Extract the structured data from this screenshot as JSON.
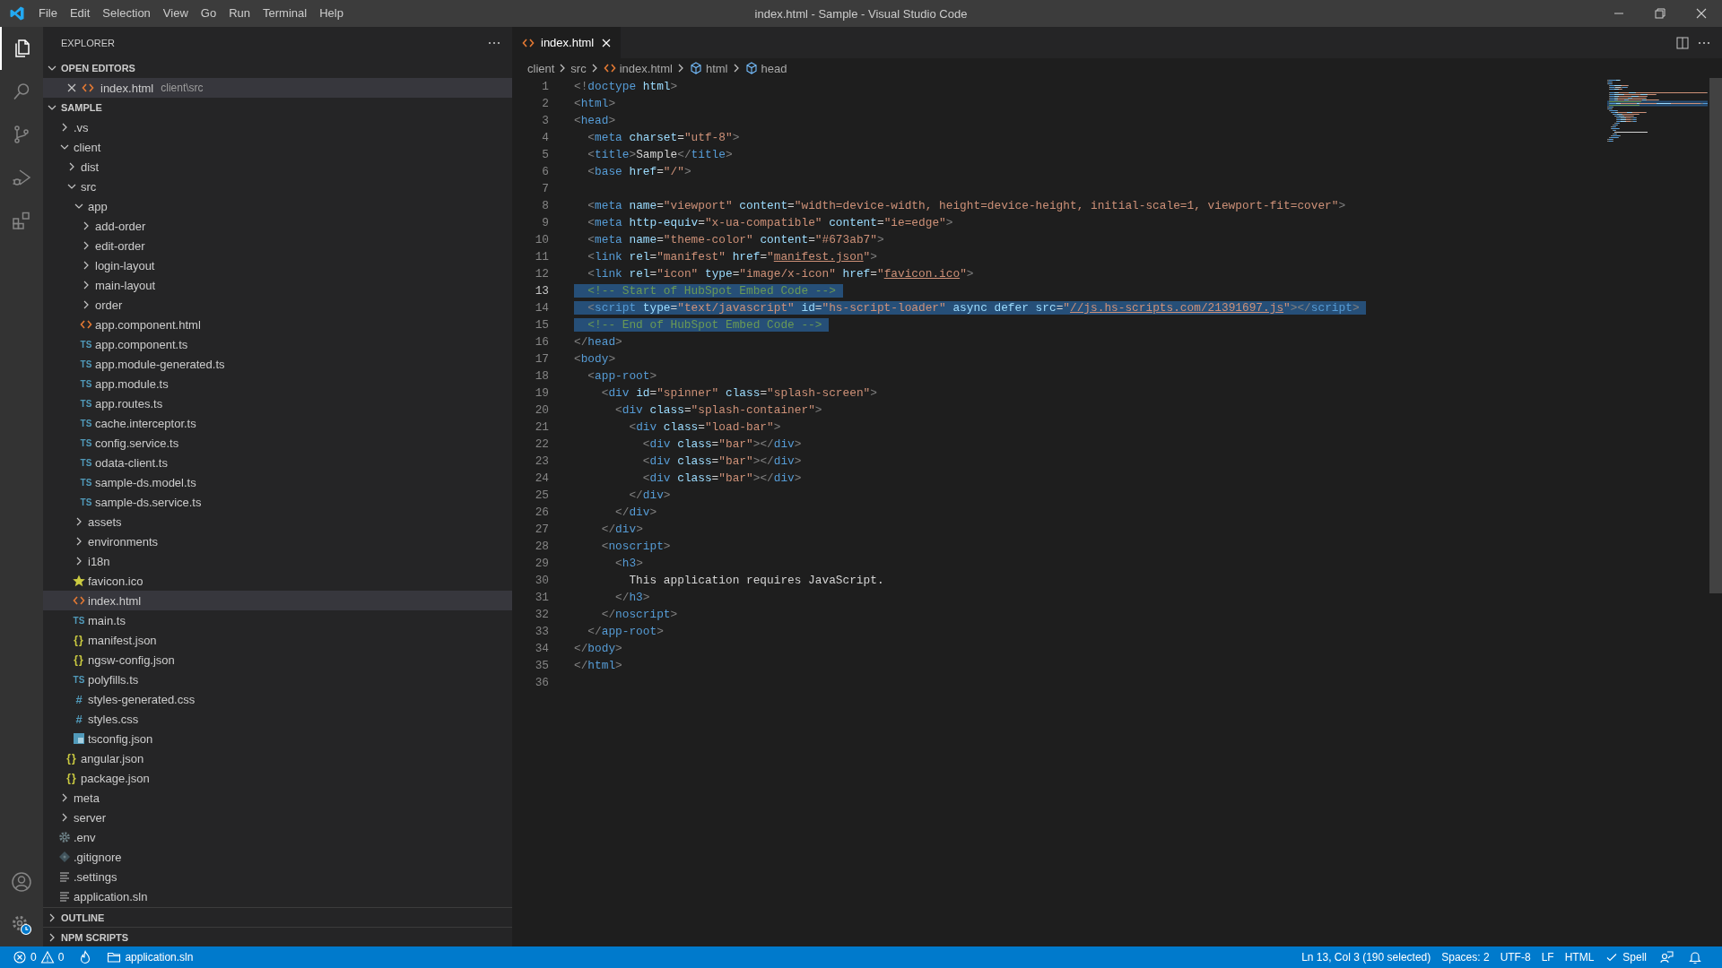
{
  "window": {
    "title": "index.html - Sample - Visual Studio Code"
  },
  "menu": [
    "File",
    "Edit",
    "Selection",
    "View",
    "Go",
    "Run",
    "Terminal",
    "Help"
  ],
  "activity_bar": {
    "top": [
      {
        "kind": "explorer",
        "selected": true
      },
      {
        "kind": "search",
        "selected": false
      },
      {
        "kind": "source-control",
        "selected": false
      },
      {
        "kind": "run",
        "selected": false
      },
      {
        "kind": "extensions",
        "selected": false
      }
    ],
    "bottom": [
      {
        "kind": "account"
      },
      {
        "kind": "settings"
      }
    ]
  },
  "sidebar": {
    "title": "EXPLORER",
    "open_editors": {
      "title": "OPEN EDITORS",
      "expanded": true,
      "items": [
        {
          "name": "index.html",
          "path": "client\\src",
          "kind": "html",
          "selected": true
        }
      ]
    },
    "folder": {
      "title": "SAMPLE",
      "expanded": true,
      "tree": [
        {
          "name": ".vs",
          "kind": "folder",
          "expanded": false,
          "selected": false
        },
        {
          "name": "client",
          "kind": "folder",
          "expanded": true,
          "selected": false,
          "children": [
            {
              "name": "dist",
              "kind": "folder",
              "expanded": false,
              "selected": false
            },
            {
              "name": "src",
              "kind": "folder",
              "expanded": true,
              "selected": false,
              "children": [
                {
                  "name": "app",
                  "kind": "folder",
                  "expanded": true,
                  "selected": false,
                  "children": [
                    {
                      "name": "add-order",
                      "kind": "folder",
                      "expanded": false,
                      "selected": false
                    },
                    {
                      "name": "edit-order",
                      "kind": "folder",
                      "expanded": false,
                      "selected": false
                    },
                    {
                      "name": "login-layout",
                      "kind": "folder",
                      "expanded": false,
                      "selected": false
                    },
                    {
                      "name": "main-layout",
                      "kind": "folder",
                      "expanded": false,
                      "selected": false
                    },
                    {
                      "name": "order",
                      "kind": "folder",
                      "expanded": false,
                      "selected": false
                    },
                    {
                      "name": "app.component.html",
                      "kind": "html",
                      "selected": false
                    },
                    {
                      "name": "app.component.ts",
                      "kind": "ts",
                      "icon_text": "TS",
                      "selected": false
                    },
                    {
                      "name": "app.module-generated.ts",
                      "kind": "ts",
                      "icon_text": "TS",
                      "selected": false
                    },
                    {
                      "name": "app.module.ts",
                      "kind": "ts",
                      "icon_text": "TS",
                      "selected": false
                    },
                    {
                      "name": "app.routes.ts",
                      "kind": "ts",
                      "icon_text": "TS",
                      "selected": false
                    },
                    {
                      "name": "cache.interceptor.ts",
                      "kind": "ts",
                      "icon_text": "TS",
                      "selected": false
                    },
                    {
                      "name": "config.service.ts",
                      "kind": "ts",
                      "icon_text": "TS",
                      "selected": false
                    },
                    {
                      "name": "odata-client.ts",
                      "kind": "ts",
                      "icon_text": "TS",
                      "selected": false
                    },
                    {
                      "name": "sample-ds.model.ts",
                      "kind": "ts",
                      "icon_text": "TS",
                      "selected": false
                    },
                    {
                      "name": "sample-ds.service.ts",
                      "kind": "ts",
                      "icon_text": "TS",
                      "selected": false
                    }
                  ]
                },
                {
                  "name": "assets",
                  "kind": "folder",
                  "expanded": false,
                  "selected": false
                },
                {
                  "name": "environments",
                  "kind": "folder",
                  "expanded": false,
                  "selected": false
                },
                {
                  "name": "i18n",
                  "kind": "folder",
                  "expanded": false,
                  "selected": false
                },
                {
                  "name": "favicon.ico",
                  "kind": "star",
                  "selected": false
                },
                {
                  "name": "index.html",
                  "kind": "html",
                  "selected": true
                },
                {
                  "name": "main.ts",
                  "kind": "ts",
                  "icon_text": "TS",
                  "selected": false
                },
                {
                  "name": "manifest.json",
                  "kind": "json",
                  "icon_text": "{}",
                  "selected": false
                },
                {
                  "name": "ngsw-config.json",
                  "kind": "json",
                  "icon_text": "{}",
                  "selected": false
                },
                {
                  "name": "polyfills.ts",
                  "kind": "ts",
                  "icon_text": "TS",
                  "selected": false
                },
                {
                  "name": "styles-generated.css",
                  "kind": "css",
                  "icon_text": "#",
                  "selected": false
                },
                {
                  "name": "styles.css",
                  "kind": "css",
                  "icon_text": "#",
                  "selected": false
                },
                {
                  "name": "tsconfig.json",
                  "kind": "tsconfig",
                  "selected": false
                }
              ]
            },
            {
              "name": "angular.json",
              "kind": "json",
              "icon_text": "{}",
              "selected": false
            },
            {
              "name": "package.json",
              "kind": "json",
              "icon_text": "{}",
              "selected": false
            }
          ]
        },
        {
          "name": "meta",
          "kind": "folder",
          "expanded": false,
          "selected": false
        },
        {
          "name": "server",
          "kind": "folder",
          "expanded": false,
          "selected": false
        },
        {
          "name": ".env",
          "kind": "gear",
          "selected": false
        },
        {
          "name": ".gitignore",
          "kind": "git",
          "selected": false
        },
        {
          "name": ".settings",
          "kind": "lines",
          "selected": false
        },
        {
          "name": "application.sln",
          "kind": "lines",
          "selected": false
        }
      ]
    },
    "sections": [
      {
        "title": "OUTLINE",
        "expanded": false
      },
      {
        "title": "NPM SCRIPTS",
        "expanded": false
      }
    ]
  },
  "editor": {
    "tabs": [
      {
        "name": "index.html",
        "kind": "html",
        "selected": true
      }
    ],
    "breadcrumbs": [
      {
        "label": "client",
        "kind": "folder"
      },
      {
        "label": "src",
        "kind": "folder"
      },
      {
        "label": "index.html",
        "kind": "html"
      },
      {
        "label": "html",
        "kind": "element"
      },
      {
        "label": "head",
        "kind": "element"
      }
    ],
    "lines": [
      {
        "number": "1",
        "active": false,
        "selected": false,
        "tokens": [
          {
            "kind": "p",
            "text": "<!"
          },
          {
            "kind": "tag",
            "text": "doctype "
          },
          {
            "kind": "attr",
            "text": "html"
          },
          {
            "kind": "p",
            "text": ">"
          }
        ]
      },
      {
        "number": "2",
        "active": false,
        "selected": false,
        "tokens": [
          {
            "kind": "p",
            "text": "<"
          },
          {
            "kind": "tag",
            "text": "html"
          },
          {
            "kind": "p",
            "text": ">"
          }
        ]
      },
      {
        "number": "3",
        "active": false,
        "selected": false,
        "tokens": [
          {
            "kind": "p",
            "text": "<"
          },
          {
            "kind": "tag",
            "text": "head"
          },
          {
            "kind": "p",
            "text": ">"
          }
        ]
      },
      {
        "number": "4",
        "active": false,
        "selected": false,
        "tokens": [
          {
            "kind": "p",
            "text": "  <"
          },
          {
            "kind": "tag",
            "text": "meta "
          },
          {
            "kind": "attr",
            "text": "charset"
          },
          {
            "kind": "eq",
            "text": "="
          },
          {
            "kind": "str",
            "text": "\"utf-8\""
          },
          {
            "kind": "p",
            "text": ">"
          }
        ]
      },
      {
        "number": "5",
        "active": false,
        "selected": false,
        "tokens": [
          {
            "kind": "p",
            "text": "  <"
          },
          {
            "kind": "tag",
            "text": "title"
          },
          {
            "kind": "p",
            "text": ">"
          },
          {
            "kind": "text",
            "text": "Sample"
          },
          {
            "kind": "p",
            "text": "</"
          },
          {
            "kind": "tag",
            "text": "title"
          },
          {
            "kind": "p",
            "text": ">"
          }
        ]
      },
      {
        "number": "6",
        "active": false,
        "selected": false,
        "tokens": [
          {
            "kind": "p",
            "text": "  <"
          },
          {
            "kind": "tag",
            "text": "base "
          },
          {
            "kind": "attr",
            "text": "href"
          },
          {
            "kind": "eq",
            "text": "="
          },
          {
            "kind": "str",
            "text": "\"/\""
          },
          {
            "kind": "p",
            "text": ">"
          }
        ]
      },
      {
        "number": "7",
        "active": false
      },
      {
        "number": "8",
        "active": false,
        "selected": false,
        "tokens": [
          {
            "kind": "p",
            "text": "  <"
          },
          {
            "kind": "tag",
            "text": "meta "
          },
          {
            "kind": "attr",
            "text": "name"
          },
          {
            "kind": "eq",
            "text": "="
          },
          {
            "kind": "str",
            "text": "\"viewport\" "
          },
          {
            "kind": "attr",
            "text": "content"
          },
          {
            "kind": "eq",
            "text": "="
          },
          {
            "kind": "str",
            "text": "\"width=device-width, height=device-height, initial-scale=1, viewport-fit=cover\""
          },
          {
            "kind": "p",
            "text": ">"
          }
        ]
      },
      {
        "number": "9",
        "active": false,
        "selected": false,
        "tokens": [
          {
            "kind": "p",
            "text": "  <"
          },
          {
            "kind": "tag",
            "text": "meta "
          },
          {
            "kind": "attr",
            "text": "http-equiv"
          },
          {
            "kind": "eq",
            "text": "="
          },
          {
            "kind": "str",
            "text": "\"x-ua-compatible\" "
          },
          {
            "kind": "attr",
            "text": "content"
          },
          {
            "kind": "eq",
            "text": "="
          },
          {
            "kind": "str",
            "text": "\"ie=edge\""
          },
          {
            "kind": "p",
            "text": ">"
          }
        ]
      },
      {
        "number": "10",
        "active": false,
        "selected": false,
        "tokens": [
          {
            "kind": "p",
            "text": "  <"
          },
          {
            "kind": "tag",
            "text": "meta "
          },
          {
            "kind": "attr",
            "text": "name"
          },
          {
            "kind": "eq",
            "text": "="
          },
          {
            "kind": "str",
            "text": "\"theme-color\" "
          },
          {
            "kind": "attr",
            "text": "content"
          },
          {
            "kind": "eq",
            "text": "="
          },
          {
            "kind": "str",
            "text": "\"#673ab7\""
          },
          {
            "kind": "p",
            "text": ">"
          }
        ]
      },
      {
        "number": "11",
        "active": false,
        "selected": false,
        "tokens": [
          {
            "kind": "p",
            "text": "  <"
          },
          {
            "kind": "tag",
            "text": "link "
          },
          {
            "kind": "attr",
            "text": "rel"
          },
          {
            "kind": "eq",
            "text": "="
          },
          {
            "kind": "str",
            "text": "\"manifest\" "
          },
          {
            "kind": "attr",
            "text": "href"
          },
          {
            "kind": "eq",
            "text": "="
          },
          {
            "kind": "str",
            "text": "\""
          },
          {
            "kind": "link",
            "text": "manifest.json"
          },
          {
            "kind": "str",
            "text": "\""
          },
          {
            "kind": "p",
            "text": ">"
          }
        ]
      },
      {
        "number": "12",
        "active": false,
        "selected": false,
        "tokens": [
          {
            "kind": "p",
            "text": "  <"
          },
          {
            "kind": "tag",
            "text": "link "
          },
          {
            "kind": "attr",
            "text": "rel"
          },
          {
            "kind": "eq",
            "text": "="
          },
          {
            "kind": "str",
            "text": "\"icon\" "
          },
          {
            "kind": "attr",
            "text": "type"
          },
          {
            "kind": "eq",
            "text": "="
          },
          {
            "kind": "str",
            "text": "\"image/x-icon\" "
          },
          {
            "kind": "attr",
            "text": "href"
          },
          {
            "kind": "eq",
            "text": "="
          },
          {
            "kind": "str",
            "text": "\""
          },
          {
            "kind": "link",
            "text": "favicon.ico"
          },
          {
            "kind": "str",
            "text": "\""
          },
          {
            "kind": "p",
            "text": ">"
          }
        ]
      },
      {
        "number": "13",
        "active": true,
        "selected": true,
        "tokens": [
          {
            "kind": "com",
            "text": "  <!-- Start of HubSpot Embed Code -->"
          }
        ]
      },
      {
        "number": "14",
        "active": false,
        "selected": true,
        "tokens": [
          {
            "kind": "p",
            "text": "  <"
          },
          {
            "kind": "tag",
            "text": "script "
          },
          {
            "kind": "attr",
            "text": "type"
          },
          {
            "kind": "eq",
            "text": "="
          },
          {
            "kind": "str",
            "text": "\"text/javascript\" "
          },
          {
            "kind": "attr",
            "text": "id"
          },
          {
            "kind": "eq",
            "text": "="
          },
          {
            "kind": "str",
            "text": "\"hs-script-loader\" "
          },
          {
            "kind": "attr",
            "text": "async "
          },
          {
            "kind": "attr",
            "text": "defer "
          },
          {
            "kind": "attr",
            "text": "src"
          },
          {
            "kind": "eq",
            "text": "="
          },
          {
            "kind": "str",
            "text": "\""
          },
          {
            "kind": "link",
            "text": "//js.hs-scripts.com/21391697.js"
          },
          {
            "kind": "str",
            "text": "\""
          },
          {
            "kind": "p",
            "text": "></"
          },
          {
            "kind": "tag",
            "text": "script"
          },
          {
            "kind": "p",
            "text": ">"
          }
        ]
      },
      {
        "number": "15",
        "active": false,
        "selected": true,
        "tokens": [
          {
            "kind": "com",
            "text": "  <!-- End of HubSpot Embed Code -->"
          }
        ]
      },
      {
        "number": "16",
        "active": false,
        "selected": false,
        "tokens": [
          {
            "kind": "p",
            "text": "</"
          },
          {
            "kind": "tag",
            "text": "head"
          },
          {
            "kind": "p",
            "text": ">"
          }
        ]
      },
      {
        "number": "17",
        "active": false,
        "selected": false,
        "tokens": [
          {
            "kind": "p",
            "text": "<"
          },
          {
            "kind": "tag",
            "text": "body"
          },
          {
            "kind": "p",
            "text": ">"
          }
        ]
      },
      {
        "number": "18",
        "active": false,
        "selected": false,
        "tokens": [
          {
            "kind": "p",
            "text": "  <"
          },
          {
            "kind": "tag",
            "text": "app-root"
          },
          {
            "kind": "p",
            "text": ">"
          }
        ]
      },
      {
        "number": "19",
        "active": false,
        "selected": false,
        "tokens": [
          {
            "kind": "p",
            "text": "    <"
          },
          {
            "kind": "tag",
            "text": "div "
          },
          {
            "kind": "attr",
            "text": "id"
          },
          {
            "kind": "eq",
            "text": "="
          },
          {
            "kind": "str",
            "text": "\"spinner\" "
          },
          {
            "kind": "attr",
            "text": "class"
          },
          {
            "kind": "eq",
            "text": "="
          },
          {
            "kind": "str",
            "text": "\"splash-screen\""
          },
          {
            "kind": "p",
            "text": ">"
          }
        ]
      },
      {
        "number": "20",
        "active": false,
        "selected": false,
        "tokens": [
          {
            "kind": "p",
            "text": "      <"
          },
          {
            "kind": "tag",
            "text": "div "
          },
          {
            "kind": "attr",
            "text": "class"
          },
          {
            "kind": "eq",
            "text": "="
          },
          {
            "kind": "str",
            "text": "\"splash-container\""
          },
          {
            "kind": "p",
            "text": ">"
          }
        ]
      },
      {
        "number": "21",
        "active": false,
        "selected": false,
        "tokens": [
          {
            "kind": "p",
            "text": "        <"
          },
          {
            "kind": "tag",
            "text": "div "
          },
          {
            "kind": "attr",
            "text": "class"
          },
          {
            "kind": "eq",
            "text": "="
          },
          {
            "kind": "str",
            "text": "\"load-bar\""
          },
          {
            "kind": "p",
            "text": ">"
          }
        ]
      },
      {
        "number": "22",
        "active": false,
        "selected": false,
        "tokens": [
          {
            "kind": "p",
            "text": "          <"
          },
          {
            "kind": "tag",
            "text": "div "
          },
          {
            "kind": "attr",
            "text": "class"
          },
          {
            "kind": "eq",
            "text": "="
          },
          {
            "kind": "str",
            "text": "\"bar\""
          },
          {
            "kind": "p",
            "text": "></"
          },
          {
            "kind": "tag",
            "text": "div"
          },
          {
            "kind": "p",
            "text": ">"
          }
        ]
      },
      {
        "number": "23",
        "active": false,
        "selected": false,
        "tokens": [
          {
            "kind": "p",
            "text": "          <"
          },
          {
            "kind": "tag",
            "text": "div "
          },
          {
            "kind": "attr",
            "text": "class"
          },
          {
            "kind": "eq",
            "text": "="
          },
          {
            "kind": "str",
            "text": "\"bar\""
          },
          {
            "kind": "p",
            "text": "></"
          },
          {
            "kind": "tag",
            "text": "div"
          },
          {
            "kind": "p",
            "text": ">"
          }
        ]
      },
      {
        "number": "24",
        "active": false,
        "selected": false,
        "tokens": [
          {
            "kind": "p",
            "text": "          <"
          },
          {
            "kind": "tag",
            "text": "div "
          },
          {
            "kind": "attr",
            "text": "class"
          },
          {
            "kind": "eq",
            "text": "="
          },
          {
            "kind": "str",
            "text": "\"bar\""
          },
          {
            "kind": "p",
            "text": "></"
          },
          {
            "kind": "tag",
            "text": "div"
          },
          {
            "kind": "p",
            "text": ">"
          }
        ]
      },
      {
        "number": "25",
        "active": false,
        "selected": false,
        "tokens": [
          {
            "kind": "p",
            "text": "        </"
          },
          {
            "kind": "tag",
            "text": "div"
          },
          {
            "kind": "p",
            "text": ">"
          }
        ]
      },
      {
        "number": "26",
        "active": false,
        "selected": false,
        "tokens": [
          {
            "kind": "p",
            "text": "      </"
          },
          {
            "kind": "tag",
            "text": "div"
          },
          {
            "kind": "p",
            "text": ">"
          }
        ]
      },
      {
        "number": "27",
        "active": false,
        "selected": false,
        "tokens": [
          {
            "kind": "p",
            "text": "    </"
          },
          {
            "kind": "tag",
            "text": "div"
          },
          {
            "kind": "p",
            "text": ">"
          }
        ]
      },
      {
        "number": "28",
        "active": false,
        "selected": false,
        "tokens": [
          {
            "kind": "p",
            "text": "    <"
          },
          {
            "kind": "tag",
            "text": "noscript"
          },
          {
            "kind": "p",
            "text": ">"
          }
        ]
      },
      {
        "number": "29",
        "active": false,
        "selected": false,
        "tokens": [
          {
            "kind": "p",
            "text": "      <"
          },
          {
            "kind": "tag",
            "text": "h3"
          },
          {
            "kind": "p",
            "text": ">"
          }
        ]
      },
      {
        "number": "30",
        "active": false,
        "selected": false,
        "tokens": [
          {
            "kind": "text",
            "text": "        This application requires JavaScript."
          }
        ]
      },
      {
        "number": "31",
        "active": false,
        "selected": false,
        "tokens": [
          {
            "kind": "p",
            "text": "      </"
          },
          {
            "kind": "tag",
            "text": "h3"
          },
          {
            "kind": "p",
            "text": ">"
          }
        ]
      },
      {
        "number": "32",
        "active": false,
        "selected": false,
        "tokens": [
          {
            "kind": "p",
            "text": "    </"
          },
          {
            "kind": "tag",
            "text": "noscript"
          },
          {
            "kind": "p",
            "text": ">"
          }
        ]
      },
      {
        "number": "33",
        "active": false,
        "selected": false,
        "tokens": [
          {
            "kind": "p",
            "text": "  </"
          },
          {
            "kind": "tag",
            "text": "app-root"
          },
          {
            "kind": "p",
            "text": ">"
          }
        ]
      },
      {
        "number": "34",
        "active": false,
        "selected": false,
        "tokens": [
          {
            "kind": "p",
            "text": "</"
          },
          {
            "kind": "tag",
            "text": "body"
          },
          {
            "kind": "p",
            "text": ">"
          }
        ]
      },
      {
        "number": "35",
        "active": false,
        "selected": false,
        "tokens": [
          {
            "kind": "p",
            "text": "</"
          },
          {
            "kind": "tag",
            "text": "html"
          },
          {
            "kind": "p",
            "text": ">"
          }
        ]
      },
      {
        "number": "36",
        "active": false
      }
    ]
  },
  "status_bar": {
    "left": [
      {
        "kind": "problems",
        "errors": "0",
        "warnings": "0"
      },
      {
        "kind": "flame"
      },
      {
        "kind": "project",
        "label": "application.sln"
      }
    ],
    "right": [
      {
        "kind": "text",
        "label": "Ln 13, Col 3 (190 selected)"
      },
      {
        "kind": "text",
        "label": "Spaces: 2"
      },
      {
        "kind": "text",
        "label": "UTF-8"
      },
      {
        "kind": "text",
        "label": "LF"
      },
      {
        "kind": "text",
        "label": "HTML"
      },
      {
        "kind": "spell",
        "label": "Spell"
      },
      {
        "kind": "feedback"
      },
      {
        "kind": "notifications"
      }
    ]
  }
}
